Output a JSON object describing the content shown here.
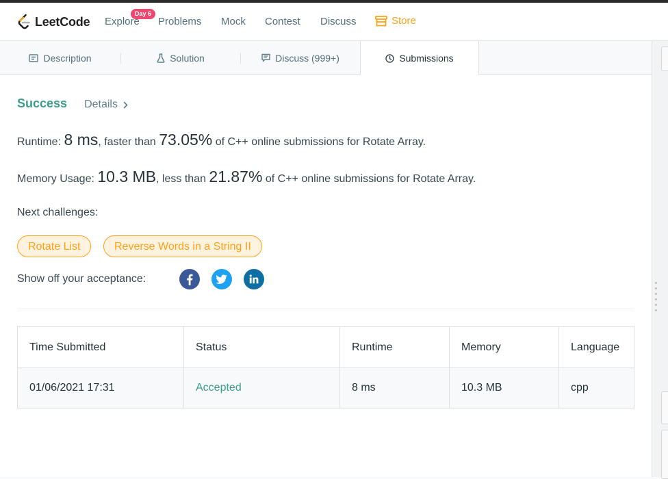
{
  "nav": {
    "brand": "LeetCode",
    "items": [
      "Explore",
      "Problems",
      "Mock",
      "Contest",
      "Discuss"
    ],
    "badge": "Day 6",
    "store": "Store"
  },
  "tabs": [
    "Description",
    "Solution",
    "Discuss (999+)",
    "Submissions"
  ],
  "result": {
    "status": "Success",
    "details": "Details",
    "runtime_label": "Runtime: ",
    "runtime_value": "8 ms",
    "runtime_mid": ", faster than ",
    "runtime_pct": "73.05%",
    "runtime_tail": " of C++ online submissions for Rotate Array.",
    "memory_label": "Memory Usage: ",
    "memory_value": "10.3 MB",
    "memory_mid": ", less than ",
    "memory_pct": "21.87%",
    "memory_tail": " of C++ online submissions for Rotate Array."
  },
  "next": {
    "label": "Next challenges:",
    "challenges": [
      "Rotate List",
      "Reverse Words in a String II"
    ]
  },
  "share": {
    "label": "Show off your acceptance:"
  },
  "table": {
    "headers": [
      "Time Submitted",
      "Status",
      "Runtime",
      "Memory",
      "Language"
    ],
    "rows": [
      [
        "01/06/2021 17:31",
        "Accepted",
        "8 ms",
        "10.3 MB",
        "cpp"
      ]
    ]
  },
  "colors": {
    "accent": "#ffa116",
    "success": "#3a9e8a",
    "badge": "#ef4770",
    "facebook": "#3b5998",
    "twitter": "#1da1f2",
    "linkedin": "#0e6fa4"
  }
}
